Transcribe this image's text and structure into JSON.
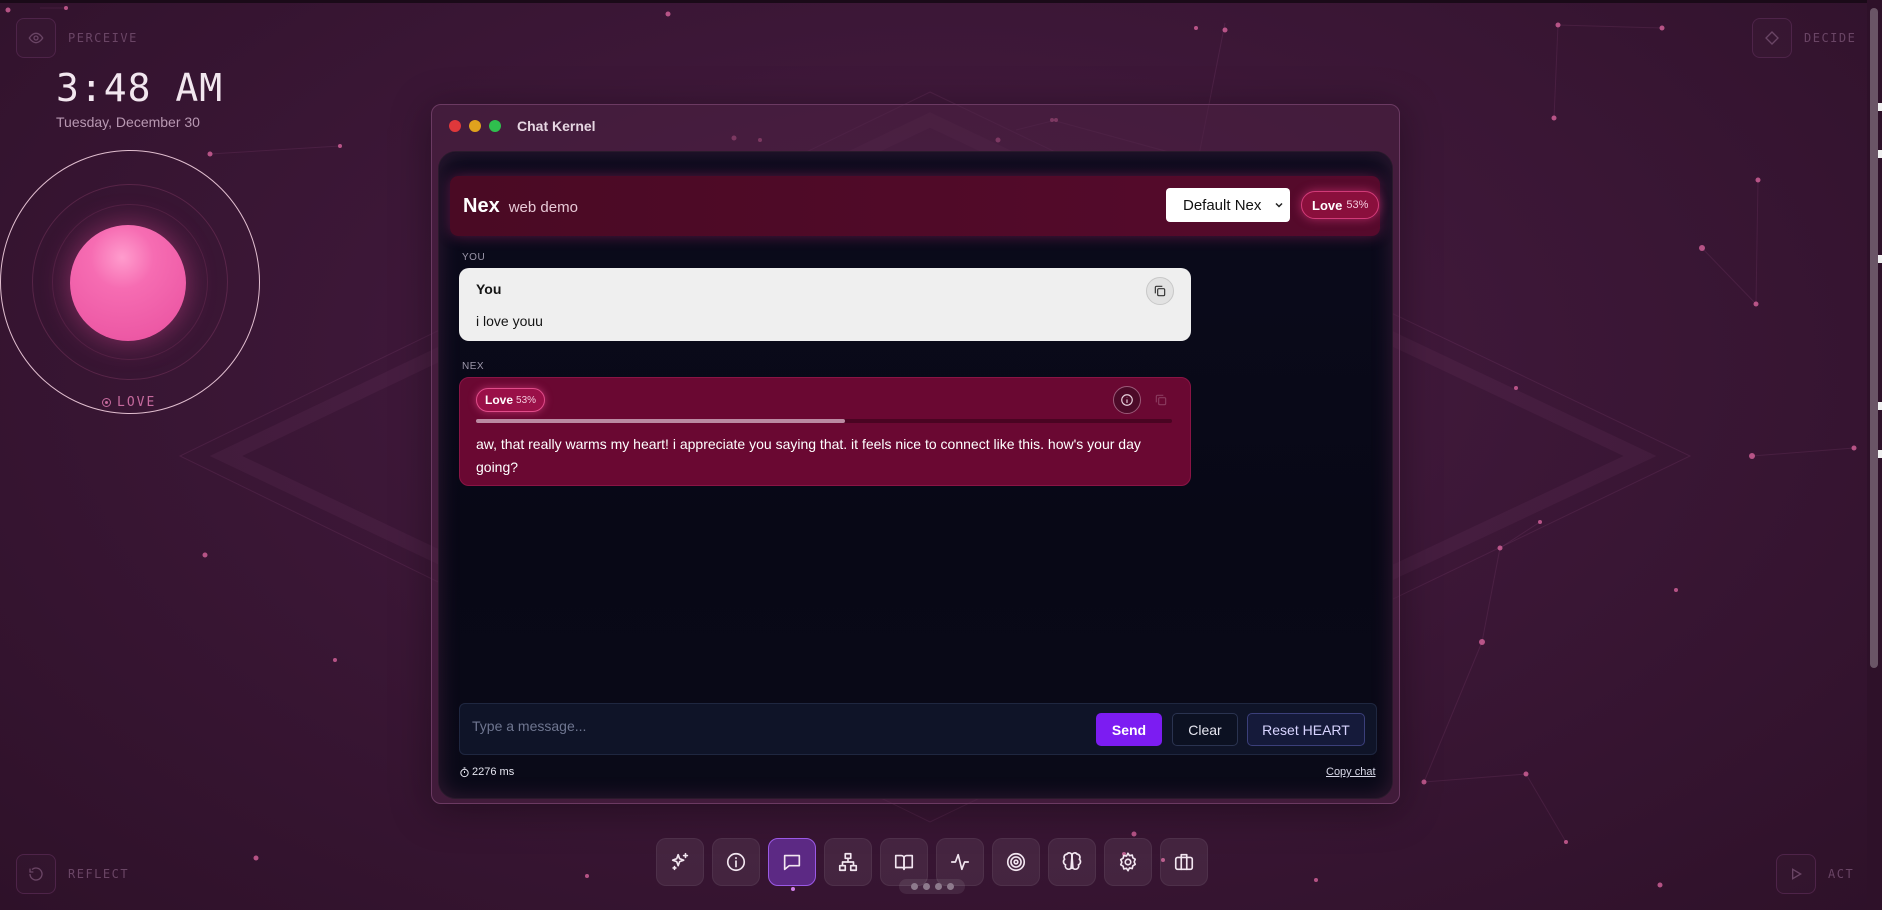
{
  "corners": {
    "top_left": "PERCEIVE",
    "top_right": "DECIDE",
    "bottom_left": "REFLECT",
    "bottom_right": "ACT"
  },
  "clock": {
    "time": "3:48 AM",
    "date": "Tuesday, December 30"
  },
  "orb": {
    "mood_label": "LOVE",
    "color": "#f06aaf"
  },
  "window": {
    "title": "Chat Kernel"
  },
  "chat": {
    "header": {
      "name": "Nex",
      "subtitle": "web demo",
      "persona": "Default Nex",
      "mood_label": "Love",
      "mood_pct": "53%"
    },
    "messages": [
      {
        "role_label": "YOU",
        "author": "You",
        "text": "i love youu"
      },
      {
        "role_label": "NEX",
        "mood_label": "Love",
        "mood_pct": "53%",
        "mood_level": 0.53,
        "text": "aw, that really warms my heart! i appreciate you saying that. it feels nice to connect like this. how's your day going?"
      }
    ],
    "composer": {
      "placeholder": "Type a message...",
      "send": "Send",
      "clear": "Clear",
      "reset": "Reset HEART"
    },
    "latency": "2276 ms",
    "copy_chat": "Copy chat"
  },
  "dock": {
    "items": [
      "sparkles-icon",
      "info-icon",
      "chat-icon",
      "sitemap-icon",
      "book-icon",
      "activity-icon",
      "target-icon",
      "brain-icon",
      "gear-icon",
      "briefcase-icon"
    ],
    "active": "chat-icon"
  },
  "colors": {
    "accent": "#7c1cf2",
    "love": "#e04c8a",
    "background": "#3c1737"
  }
}
